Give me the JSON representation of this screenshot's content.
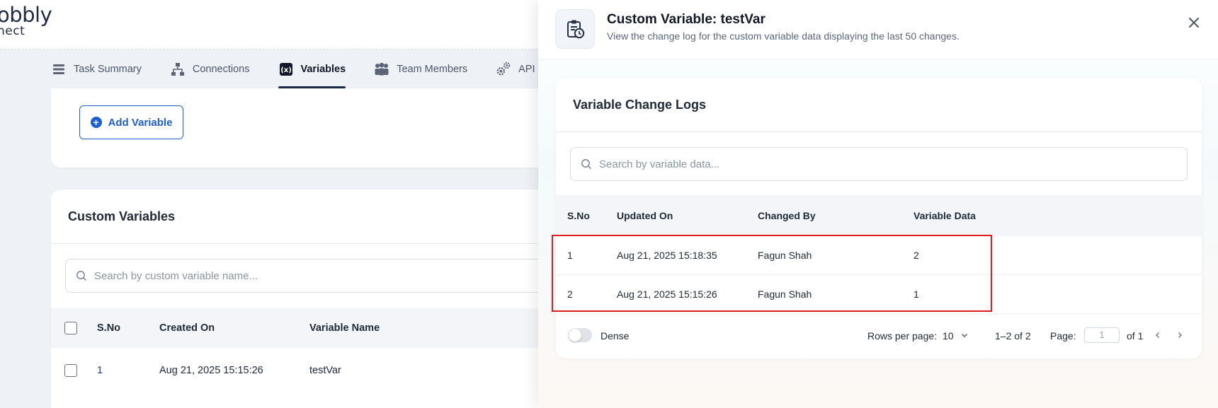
{
  "brand": {
    "logo_line1": "obbly",
    "logo_line2": "nect"
  },
  "tabs": [
    {
      "label": "Task Summary",
      "icon": "list-icon",
      "active": false
    },
    {
      "label": "Connections",
      "icon": "network-icon",
      "active": false
    },
    {
      "label": "Variables",
      "icon": "variable-icon",
      "active": true
    },
    {
      "label": "Team Members",
      "icon": "team-icon",
      "active": false
    },
    {
      "label": "API",
      "icon": "gears-icon",
      "active": false
    }
  ],
  "variables_card": {
    "add_button_label": "Add Variable"
  },
  "custom_variables": {
    "title": "Custom Variables",
    "search_placeholder": "Search by custom variable name...",
    "columns": [
      "S.No",
      "Created On",
      "Variable Name"
    ],
    "rows": [
      {
        "sno": "1",
        "created_on": "Aug 21, 2025 15:15:26",
        "name": "testVar"
      }
    ]
  },
  "drawer": {
    "title": "Custom Variable: testVar",
    "subtitle": "View the change log for the custom variable data displaying the last 50 changes.",
    "card_title": "Variable Change Logs",
    "search_placeholder": "Search by variable data...",
    "columns": [
      "S.No",
      "Updated On",
      "Changed By",
      "Variable Data"
    ],
    "rows": [
      {
        "sno": "1",
        "updated_on": "Aug 21, 2025 15:18:35",
        "changed_by": "Fagun Shah",
        "data": "2"
      },
      {
        "sno": "2",
        "updated_on": "Aug 21, 2025 15:15:26",
        "changed_by": "Fagun Shah",
        "data": "1"
      }
    ],
    "footer": {
      "dense_label": "Dense",
      "rows_per_page_label": "Rows per page:",
      "rows_per_page_value": "10",
      "range_text": "1–2 of 2",
      "page_label": "Page:",
      "page_value": "1",
      "page_total": "of 1"
    }
  },
  "colors": {
    "accent": "#1d5fd1",
    "highlight": "#e01c1c",
    "active_tab": "#1a2b4a"
  }
}
